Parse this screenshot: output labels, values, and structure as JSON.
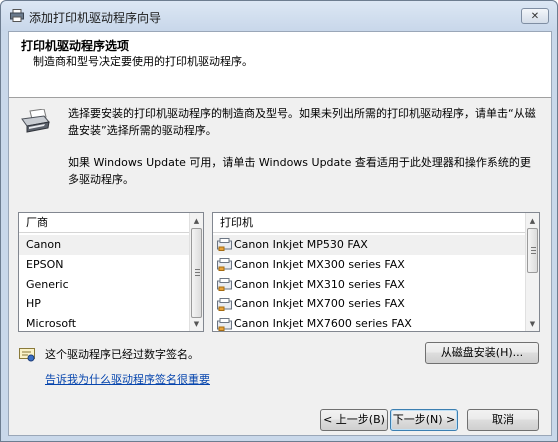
{
  "window": {
    "title": "添加打印机驱动程序向导",
    "close_glyph": "✕"
  },
  "header": {
    "title": "打印机驱动程序选项",
    "subtitle": "制造商和型号决定要使用的打印机驱动程序。"
  },
  "instructions": {
    "line1": "选择要安装的打印机驱动程序的制造商及型号。如果未列出所需的打印机驱动程序，请单击“从磁盘安装”选择所需的驱动程序。",
    "line2": "如果 Windows Update 可用，请单击 Windows Update 查看适用于此处理器和操作系统的更多驱动程序。"
  },
  "manufacturer_list": {
    "header": "厂商",
    "items": [
      "Canon",
      "EPSON",
      "Generic",
      "HP",
      "Microsoft"
    ],
    "selected": "Canon"
  },
  "printer_list": {
    "header": "打印机",
    "items": [
      "Canon Inkjet MP530 FAX",
      "Canon Inkjet MX300 series FAX",
      "Canon Inkjet MX310 series FAX",
      "Canon Inkjet MX700 series FAX",
      "Canon Inkjet MX7600 series FAX"
    ],
    "selected": "Canon Inkjet MP530 FAX",
    "item_icon": "fax-printer-icon"
  },
  "signature": {
    "text": "这个驱动程序已经过数字签名。",
    "link": "告诉我为什么驱动程序签名很重要"
  },
  "buttons": {
    "have_disk": "从磁盘安装(H)...",
    "back": "< 上一步(B)",
    "next": "下一步(N) >",
    "cancel": "取消"
  },
  "colors": {
    "link": "#0645ad",
    "frame": "#c9d8ea",
    "face": "#f0f0f0"
  }
}
